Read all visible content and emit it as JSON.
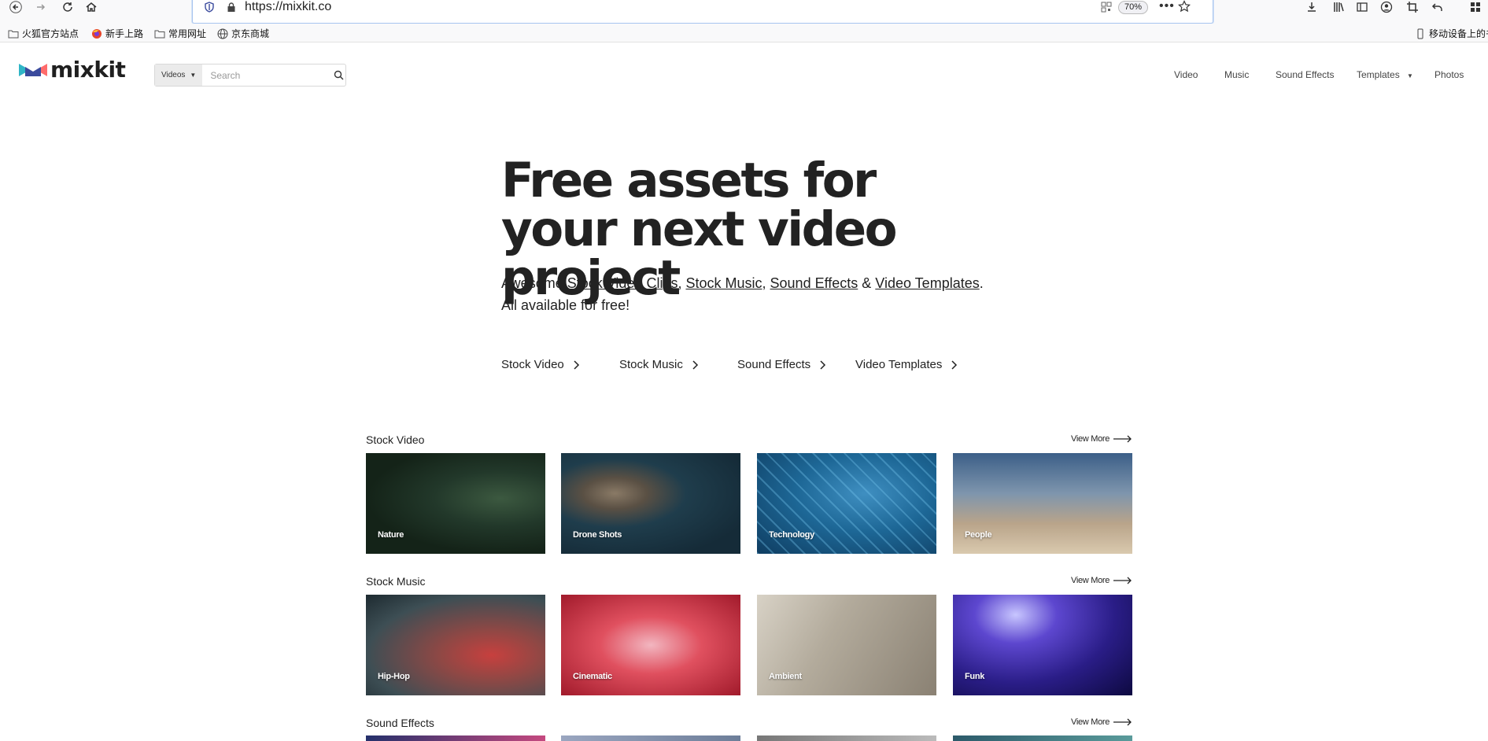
{
  "browser": {
    "url": "https://mixkit.co",
    "zoom": "70%",
    "bookmarks": [
      "火狐官方站点",
      "新手上路",
      "常用网址",
      "京东商城"
    ],
    "mobile_bookmarks": "移动设备上的书"
  },
  "site": {
    "logo_text": "mixkit",
    "search": {
      "type_label": "Videos",
      "placeholder": "Search"
    },
    "nav": {
      "video": "Video",
      "music": "Music",
      "sound_effects": "Sound Effects",
      "templates": "Templates",
      "photos": "Photos"
    }
  },
  "hero": {
    "title": "Free assets for your next video project",
    "sub_prefix": "Awesome ",
    "links": [
      "Stock Video Clips",
      "Stock Music",
      "Sound Effects",
      "Video Templates"
    ],
    "sub_sep1": ", ",
    "sub_sep2": ", ",
    "sub_sep3": " & ",
    "sub_end": ".",
    "sub_line2": "All available for free!",
    "categories": [
      "Stock Video",
      "Stock Music",
      "Sound Effects",
      "Video Templates"
    ]
  },
  "sections": [
    {
      "title": "Stock Video",
      "view_more": "View More",
      "cards": [
        "Nature",
        "Drone Shots",
        "Technology",
        "People"
      ]
    },
    {
      "title": "Stock Music",
      "view_more": "View More",
      "cards": [
        "Hip-Hop",
        "Cinematic",
        "Ambient",
        "Funk"
      ]
    },
    {
      "title": "Sound Effects",
      "view_more": "View More",
      "cards": [
        "",
        "",
        "",
        ""
      ]
    }
  ],
  "colors": {
    "brand_coral": "#ff6b6b",
    "brand_teal": "#2fb5c6",
    "brand_navy": "#3a4a9d",
    "text": "#222222"
  }
}
